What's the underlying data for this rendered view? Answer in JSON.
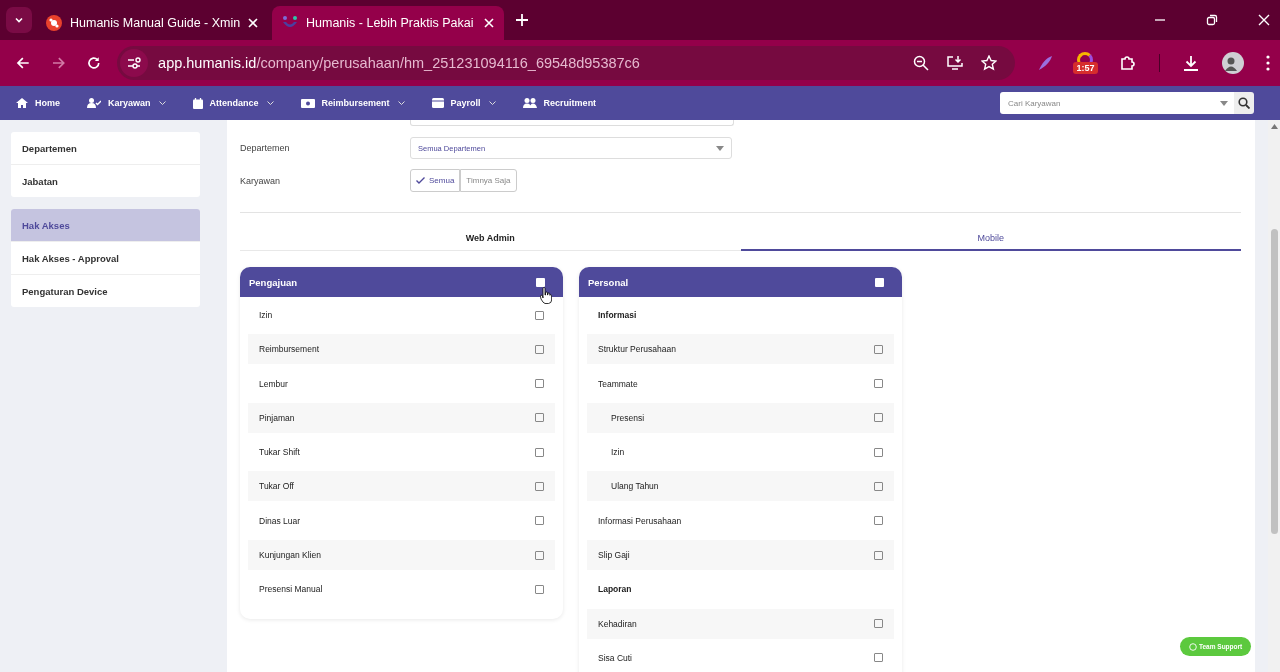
{
  "browser": {
    "tabs": [
      {
        "title": "Humanis Manual Guide - Xmin",
        "selected": false
      },
      {
        "title": "Humanis - Lebih Praktis Pakai",
        "selected": true
      }
    ],
    "url_host": "app.humanis.id",
    "url_path": "/company/perusahaan/hm_251231094116_69548d95387c6",
    "timer_badge": "1:57"
  },
  "navbar": {
    "items": [
      {
        "label": "Home",
        "dropdown": false
      },
      {
        "label": "Karyawan",
        "dropdown": true
      },
      {
        "label": "Attendance",
        "dropdown": true
      },
      {
        "label": "Reimbursement",
        "dropdown": true
      },
      {
        "label": "Payroll",
        "dropdown": true
      },
      {
        "label": "Recruitment",
        "dropdown": false
      }
    ],
    "search": {
      "placeholder": "Cari Karyawan"
    }
  },
  "sidebar": {
    "groups": [
      [
        {
          "label": "Departemen",
          "selected": false
        },
        {
          "label": "Jabatan",
          "selected": false
        }
      ],
      [
        {
          "label": "Hak Akses",
          "selected": true
        },
        {
          "label": "Hak Akses - Approval",
          "selected": false
        },
        {
          "label": "Pengaturan Device",
          "selected": false
        }
      ]
    ]
  },
  "form": {
    "departemen": {
      "label": "Departemen",
      "value": "Semua Departemen"
    },
    "karyawan": {
      "label": "Karyawan",
      "options": [
        {
          "label": "Semua",
          "selected": true
        },
        {
          "label": "Timnya Saja",
          "selected": false
        }
      ]
    }
  },
  "tabs": [
    {
      "label": "Web Admin",
      "selected": false
    },
    {
      "label": "Mobile",
      "selected": true
    }
  ],
  "panels": [
    {
      "title": "Pengajuan",
      "checked": false,
      "items": [
        {
          "kind": "item",
          "label": "Izin",
          "checked": false
        },
        {
          "kind": "item",
          "label": "Reimbursement",
          "checked": false
        },
        {
          "kind": "item",
          "label": "Lembur",
          "checked": false
        },
        {
          "kind": "item",
          "label": "Pinjaman",
          "checked": false
        },
        {
          "kind": "item",
          "label": "Tukar Shift",
          "checked": false
        },
        {
          "kind": "item",
          "label": "Tukar Off",
          "checked": false
        },
        {
          "kind": "item",
          "label": "Dinas Luar",
          "checked": false
        },
        {
          "kind": "item",
          "label": "Kunjungan Klien",
          "checked": false
        },
        {
          "kind": "item",
          "label": "Presensi Manual",
          "checked": false
        }
      ]
    },
    {
      "title": "Personal",
      "checked": false,
      "items": [
        {
          "kind": "header",
          "label": "Informasi"
        },
        {
          "kind": "item",
          "label": "Struktur Perusahaan",
          "checked": false
        },
        {
          "kind": "item",
          "label": "Teammate",
          "checked": false,
          "children": [
            {
              "kind": "item",
              "label": "Presensi",
              "checked": false
            },
            {
              "kind": "item",
              "label": "Izin",
              "checked": false
            },
            {
              "kind": "item",
              "label": "Ulang Tahun",
              "checked": false
            }
          ]
        },
        {
          "kind": "item",
          "label": "Informasi Perusahaan",
          "checked": false
        },
        {
          "kind": "item",
          "label": "Slip Gaji",
          "checked": false
        },
        {
          "kind": "header",
          "label": "Laporan"
        },
        {
          "kind": "item",
          "label": "Kehadiran",
          "checked": false
        },
        {
          "kind": "item",
          "label": "Sisa Cuti",
          "checked": false
        }
      ]
    }
  ],
  "support_button": "Team Support"
}
